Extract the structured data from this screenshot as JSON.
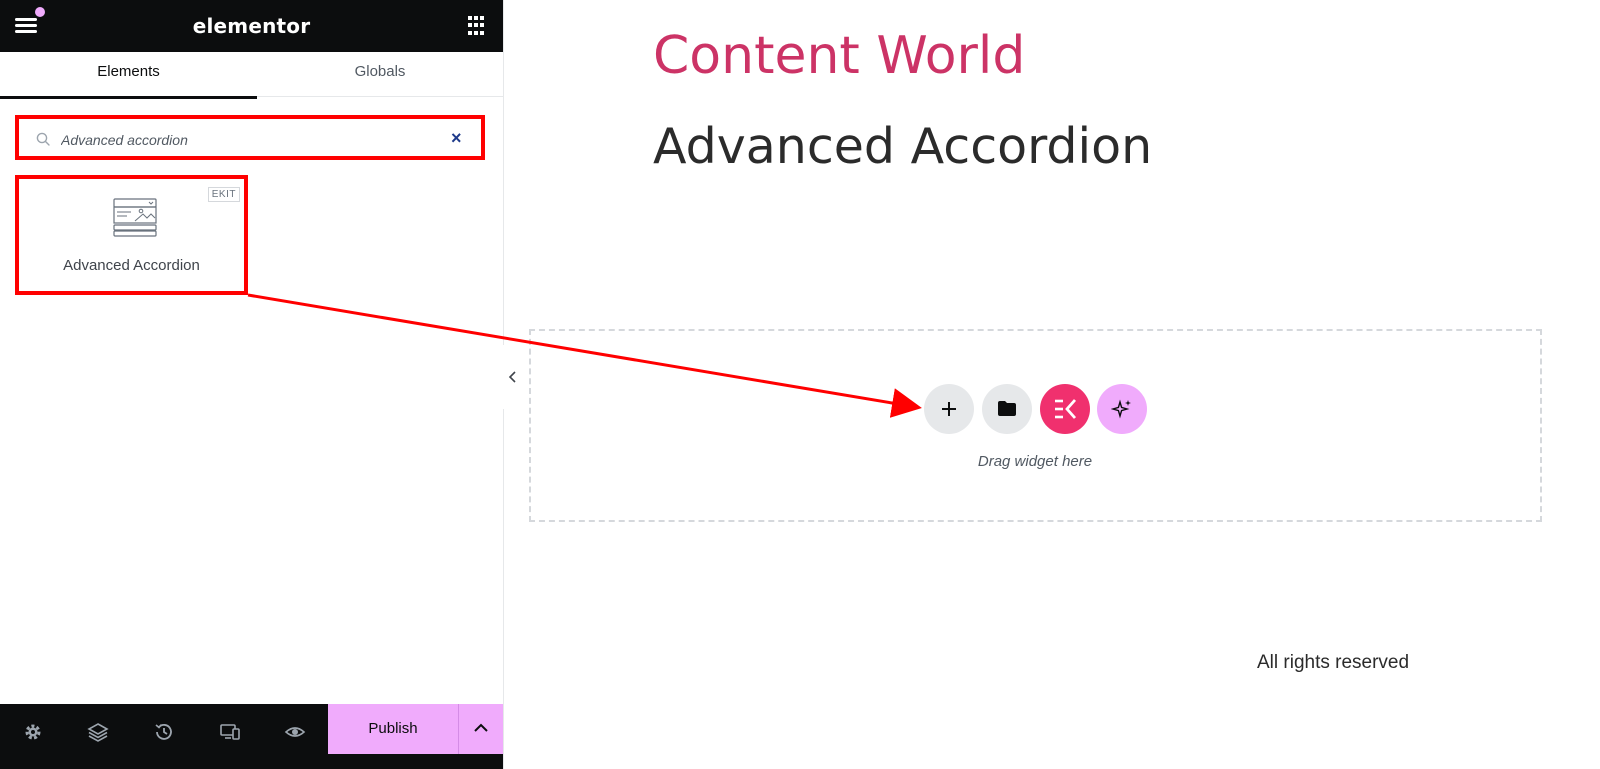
{
  "panel": {
    "brand": "elementor",
    "tabs": [
      {
        "label": "Elements",
        "active": true
      },
      {
        "label": "Globals",
        "active": false
      }
    ],
    "search": {
      "value": "Advanced accordion",
      "clear_icon": "close-icon"
    },
    "results": [
      {
        "label": "Advanced Accordion",
        "badge": "EKIT",
        "icon": "accordion-widget-icon"
      }
    ],
    "footer": {
      "icons": [
        "settings-icon",
        "layers-icon",
        "history-icon",
        "responsive-icon",
        "preview-icon"
      ],
      "publish_label": "Publish"
    }
  },
  "canvas": {
    "site_title": "Content World",
    "page_heading": "Advanced Accordion",
    "drop_zone": {
      "buttons": [
        "add-section-icon",
        "template-library-icon",
        "elementskit-icon",
        "ai-icon"
      ],
      "hint": "Drag widget here"
    },
    "footer_text": "All rights reserved"
  },
  "colors": {
    "header_bg": "#0c0d0e",
    "accent_pink": "#f0abfc",
    "site_title": "#cc3366",
    "ekit_red": "#f0306e",
    "annotation_red": "#ff0000"
  }
}
